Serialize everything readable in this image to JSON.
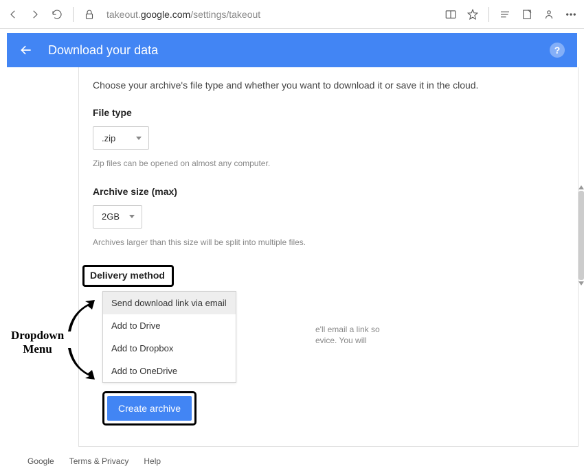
{
  "browser": {
    "url_prefix": "takeout.",
    "url_host": "google.com",
    "url_path": "/settings/takeout"
  },
  "header": {
    "title": "Download your data"
  },
  "intro": "Choose your archive's file type and whether you want to download it or save it in the cloud.",
  "filetype": {
    "label": "File type",
    "value": ".zip",
    "hint": "Zip files can be opened on almost any computer."
  },
  "archivesize": {
    "label": "Archive size (max)",
    "value": "2GB",
    "hint": "Archives larger than this size will be split into multiple files."
  },
  "delivery": {
    "label": "Delivery method",
    "options": [
      "Send download link via email",
      "Add to Drive",
      "Add to Dropbox",
      "Add to OneDrive"
    ],
    "behind_text_1": "e'll email a link so",
    "behind_text_2": "evice. You will"
  },
  "create_button": "Create archive",
  "footer": {
    "google": "Google",
    "terms": "Terms & Privacy",
    "help": "Help"
  },
  "annotation": {
    "line1": "Dropdown",
    "line2": "Menu"
  }
}
